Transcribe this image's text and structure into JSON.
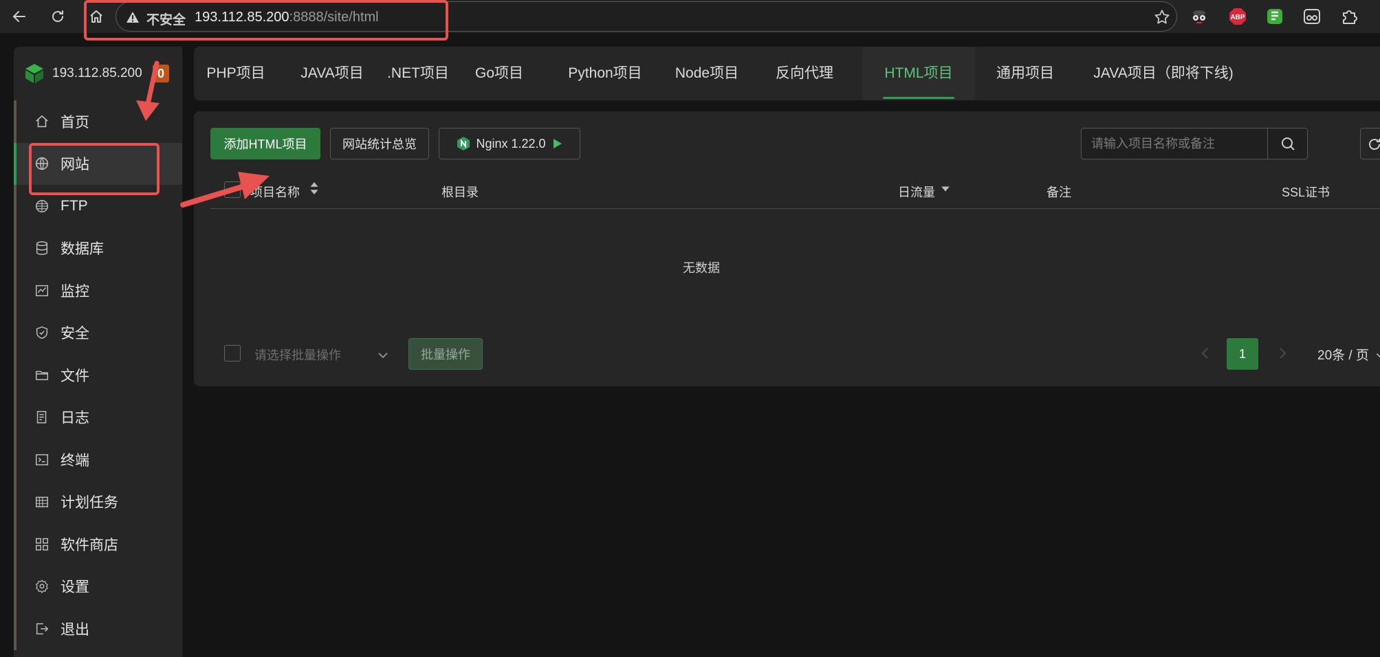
{
  "browser": {
    "security_label": "不安全",
    "url_host": "193.112.85.200",
    "url_path": ":8888/site/html",
    "extensions": [
      "spy-icon",
      "ABP",
      "grammar-icon",
      "reader-icon",
      "puzzle-icon"
    ],
    "abp_label": "ABP"
  },
  "sidebar": {
    "host": "193.112.85.200",
    "badge": "0",
    "items": [
      {
        "label": "首页",
        "icon": "home-icon"
      },
      {
        "label": "网站",
        "icon": "globe-icon",
        "active": true
      },
      {
        "label": "FTP",
        "icon": "ftp-globe-icon"
      },
      {
        "label": "数据库",
        "icon": "database-icon"
      },
      {
        "label": "监控",
        "icon": "monitor-icon"
      },
      {
        "label": "安全",
        "icon": "shield-icon"
      },
      {
        "label": "文件",
        "icon": "folder-icon"
      },
      {
        "label": "日志",
        "icon": "log-icon"
      },
      {
        "label": "终端",
        "icon": "terminal-icon"
      },
      {
        "label": "计划任务",
        "icon": "calendar-icon"
      },
      {
        "label": "软件商店",
        "icon": "apps-icon"
      },
      {
        "label": "设置",
        "icon": "gear-icon"
      },
      {
        "label": "退出",
        "icon": "logout-icon"
      }
    ]
  },
  "tabs": [
    {
      "label": "PHP项目"
    },
    {
      "label": "JAVA项目"
    },
    {
      "label": ".NET项目"
    },
    {
      "label": "Go项目"
    },
    {
      "label": "Python项目"
    },
    {
      "label": "Node项目"
    },
    {
      "label": "反向代理"
    },
    {
      "label": "HTML项目",
      "active": true
    },
    {
      "label": "通用项目"
    },
    {
      "label": "JAVA项目（即将下线)"
    }
  ],
  "toolbar": {
    "add_label": "添加HTML项目",
    "stats_label": "网站统计总览",
    "nginx_label": "Nginx 1.22.0",
    "search_placeholder": "请输入项目名称或备注"
  },
  "table": {
    "columns": [
      "项目名称",
      "根目录",
      "日流量",
      "备注",
      "SSL证书"
    ],
    "empty_text": "无数据"
  },
  "footer": {
    "batch_placeholder": "请选择批量操作",
    "batch_button": "批量操作",
    "current_page": "1",
    "page_size": "20条 / 页"
  },
  "colors": {
    "accent": "#2f9e54",
    "primary_button": "#2d7a3d",
    "annotation_red": "#e8524f"
  }
}
